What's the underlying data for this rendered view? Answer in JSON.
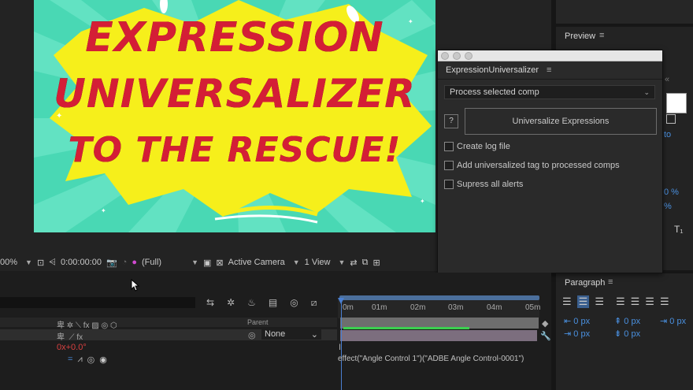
{
  "artwork": {
    "line1": "EXPRESSION",
    "line2": "UNIVERSALIZER",
    "line3": "TO THE RESCUE!"
  },
  "viewer_toolbar": {
    "zoom": "00%",
    "timecode": "0:00:00:00",
    "resolution": "(Full)",
    "camera": "Active Camera",
    "views": "1 View"
  },
  "right_panel": {
    "preview_title": "Preview",
    "paragraph_title": "Paragraph",
    "partial_auto": "to",
    "partial_pct1": "0 %",
    "partial_pct2": "%",
    "subscript_btn": "T₁",
    "indent_values": [
      "0 px",
      "0 px",
      "0 px",
      "0 px",
      "0 px"
    ]
  },
  "plugin": {
    "title": "ExpressionUniversalizer",
    "mode_select": "Process selected comp",
    "help_label": "?",
    "action_button": "Universalize Expressions",
    "options": [
      {
        "label": "Create log file",
        "checked": false
      },
      {
        "label": "Add universalized tag to processed comps",
        "checked": false
      },
      {
        "label": "Supress all alerts",
        "checked": false
      }
    ]
  },
  "timeline": {
    "parent_header": "Parent",
    "parent_value": "None",
    "rotation_value": "0x+0.0°",
    "ruler_ticks": [
      "0m",
      "01m",
      "02m",
      "03m",
      "04m",
      "05m"
    ],
    "expression": "effect(\"Angle Control 1\")(\"ADBE Angle Control-0001\")"
  },
  "colors": {
    "accent": "#4a7fd1",
    "artboard_bg": "#49d8b4",
    "burst": "#f6ef1b",
    "text_red": "#d41e36"
  }
}
